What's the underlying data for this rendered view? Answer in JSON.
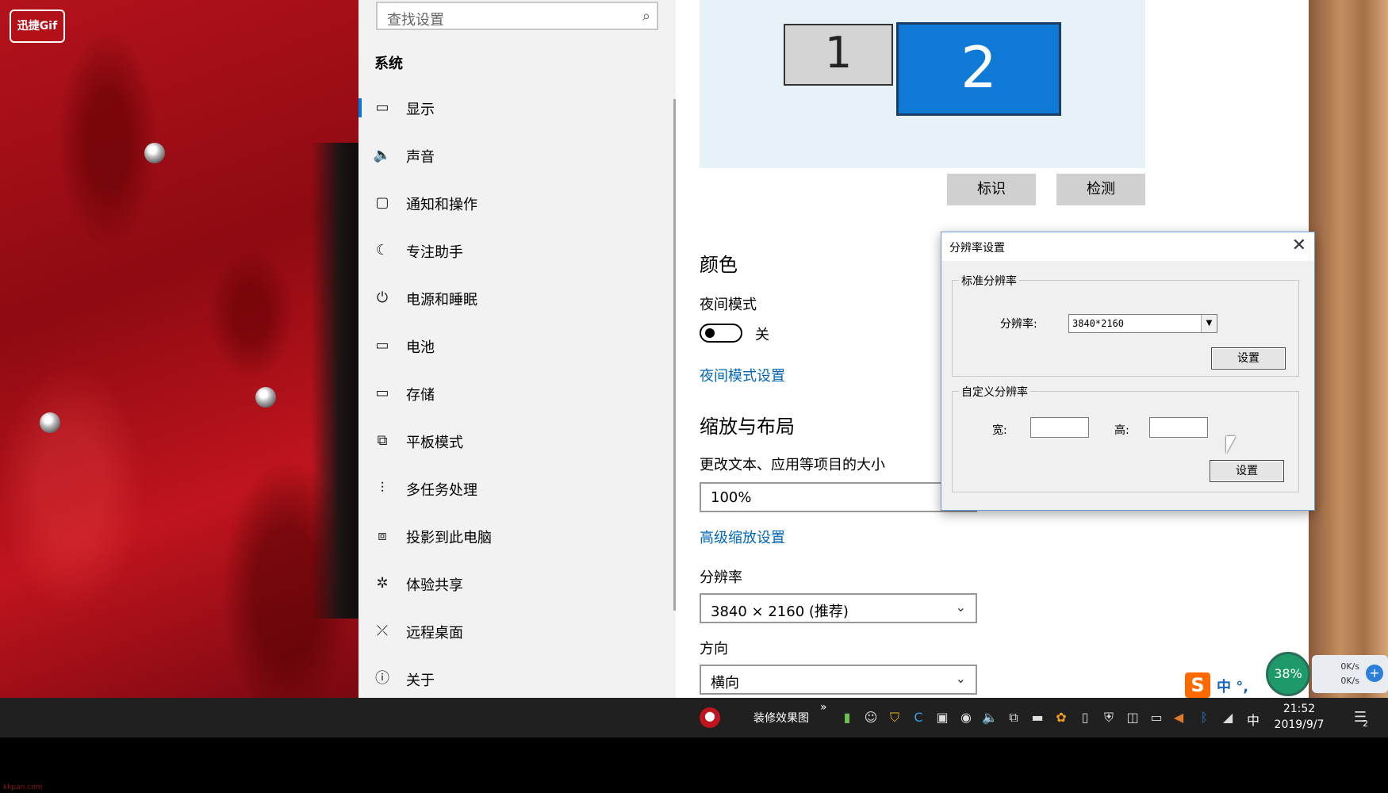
{
  "wallpaper": {
    "logo_text": "迅捷Gif"
  },
  "settings_nav": {
    "search_placeholder": "查找设置",
    "heading": "系统",
    "items": [
      {
        "label": "显示",
        "icon": "monitor-icon",
        "glyph": "▭"
      },
      {
        "label": "声音",
        "icon": "speaker-icon",
        "glyph": "🔈"
      },
      {
        "label": "通知和操作",
        "icon": "notification-icon",
        "glyph": "▢"
      },
      {
        "label": "专注助手",
        "icon": "moon-icon",
        "glyph": "☾"
      },
      {
        "label": "电源和睡眠",
        "icon": "power-icon",
        "glyph": "⏻"
      },
      {
        "label": "电池",
        "icon": "battery-icon",
        "glyph": "▭"
      },
      {
        "label": "存储",
        "icon": "storage-icon",
        "glyph": "▭"
      },
      {
        "label": "平板模式",
        "icon": "tablet-icon",
        "glyph": "⧉"
      },
      {
        "label": "多任务处理",
        "icon": "multitask-icon",
        "glyph": "⫶"
      },
      {
        "label": "投影到此电脑",
        "icon": "project-icon",
        "glyph": "⧈"
      },
      {
        "label": "体验共享",
        "icon": "share-icon",
        "glyph": "✲"
      },
      {
        "label": "远程桌面",
        "icon": "remote-icon",
        "glyph": "⤫"
      },
      {
        "label": "关于",
        "icon": "info-icon",
        "glyph": "ⓘ"
      }
    ],
    "active_index": 0
  },
  "display": {
    "monitor_1": "1",
    "monitor_2": "2",
    "identify_button": "标识",
    "detect_button": "检测",
    "color_heading": "颜色",
    "night_mode_label": "夜间模式",
    "night_mode_state": "关",
    "night_mode_link": "夜间模式设置",
    "scale_heading": "缩放与布局",
    "scale_label": "更改文本、应用等项目的大小",
    "scale_value": "100%",
    "advanced_scale_link": "高级缩放设置",
    "resolution_label": "分辨率",
    "resolution_value": "3840 × 2160 (推荐)",
    "orientation_label": "方向",
    "orientation_value": "横向"
  },
  "dialog": {
    "title": "分辨率设置",
    "standard_group": "标准分辨率",
    "resolution_label": "分辨率:",
    "resolution_value": "3840*2160",
    "set_button_1": "设置",
    "custom_group": "自定义分辨率",
    "width_label": "宽:",
    "height_label": "高:",
    "width_value": "",
    "height_value": "",
    "set_button_2": "设置"
  },
  "overlay": {
    "ime_logo": "S",
    "ime_mode": "中 °,",
    "cpu_percent": "38%",
    "net_up": "0K/s",
    "net_down": "0K/s"
  },
  "taskbar": {
    "app_label": "装修效果图",
    "more": "»",
    "ime_indicator": "中",
    "time": "21:52",
    "date": "2019/9/7",
    "notification_count": "2"
  },
  "watermark": {
    "left": "kkpan.com"
  },
  "colors": {
    "accent": "#0078d7",
    "link": "#0067b8",
    "taskbar": "#202020"
  }
}
